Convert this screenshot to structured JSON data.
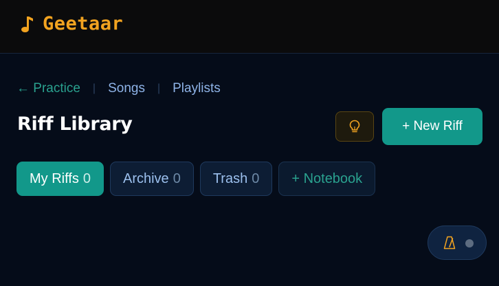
{
  "app": {
    "name": "Geetaar",
    "brand_color": "#f2a320",
    "accent_color": "#12988a",
    "logo_icon": "music-note-icon"
  },
  "breadcrumb": {
    "back_label": "← Practice",
    "items": [
      "Songs",
      "Playlists"
    ],
    "separator": "|"
  },
  "page": {
    "title": "Riff Library"
  },
  "toolbar": {
    "idea_icon": "lightbulb-icon",
    "new_label": "+ New Riff"
  },
  "tabs": [
    {
      "label": "My Riffs",
      "count": "0",
      "active": true
    },
    {
      "label": "Archive",
      "count": "0",
      "active": false
    },
    {
      "label": "Trash",
      "count": "0",
      "active": false
    },
    {
      "label": "+ Notebook",
      "active": false
    }
  ],
  "metronome_toggle": {
    "icon": "metronome-icon",
    "state": "off"
  }
}
